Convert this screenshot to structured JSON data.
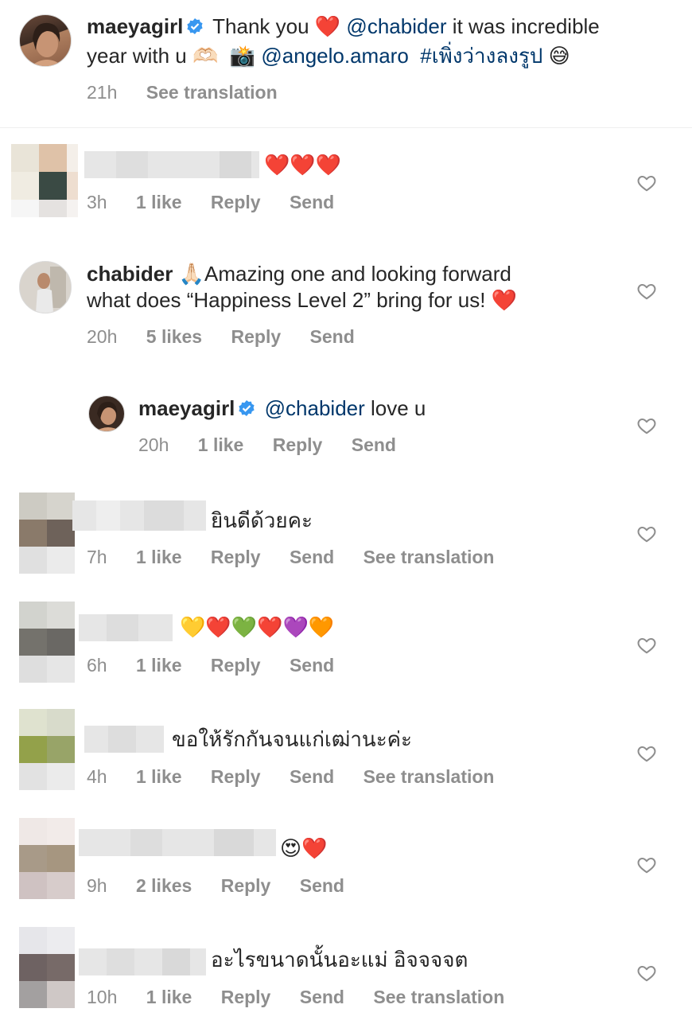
{
  "caption": {
    "username": "maeyagirl",
    "text_1": "Thank you",
    "mention_1": "@chabider",
    "text_2": "it was incredible",
    "text_3": "year with u",
    "mention_2": "@angelo.amaro",
    "hashtag": "#เพิ่งว่างลงรูป",
    "time": "21h",
    "see_translation": "See translation"
  },
  "comments": [
    {
      "emojis": "❤️❤️❤️",
      "time": "3h",
      "likes": "1 like",
      "reply": "Reply",
      "send": "Send"
    },
    {
      "username": "chabider",
      "text_1": "🙏🏻Amazing one and looking forward",
      "text_2": "what does “Happiness Level 2” bring for us! ❤️",
      "time": "20h",
      "likes": "5 likes",
      "reply": "Reply",
      "send": "Send"
    },
    {
      "username": "maeyagirl",
      "mention": "@chabider",
      "text": "love u",
      "time": "20h",
      "likes": "1 like",
      "reply": "Reply",
      "send": "Send"
    },
    {
      "text": "ยินดีด้วยคะ",
      "time": "7h",
      "likes": "1 like",
      "reply": "Reply",
      "send": "Send",
      "see_translation": "See translation"
    },
    {
      "emojis": "💛❤️💚❤️💜🧡",
      "time": "6h",
      "likes": "1 like",
      "reply": "Reply",
      "send": "Send"
    },
    {
      "text": "ขอให้รักกันจนแก่เฒ่านะค่ะ",
      "time": "4h",
      "likes": "1 like",
      "reply": "Reply",
      "send": "Send",
      "see_translation": "See translation"
    },
    {
      "emojis": "😍❤️",
      "time": "9h",
      "likes": "2 likes",
      "reply": "Reply",
      "send": "Send"
    },
    {
      "text": "อะไรขนาดนั้นอะแม่ อิจจจจต",
      "time": "10h",
      "likes": "1 like",
      "reply": "Reply",
      "send": "Send",
      "see_translation": "See translation"
    }
  ],
  "colors": {
    "link": "#00376b",
    "meta": "#8e8e8e",
    "verified": "#3897f0",
    "heart": "#ed4956"
  }
}
